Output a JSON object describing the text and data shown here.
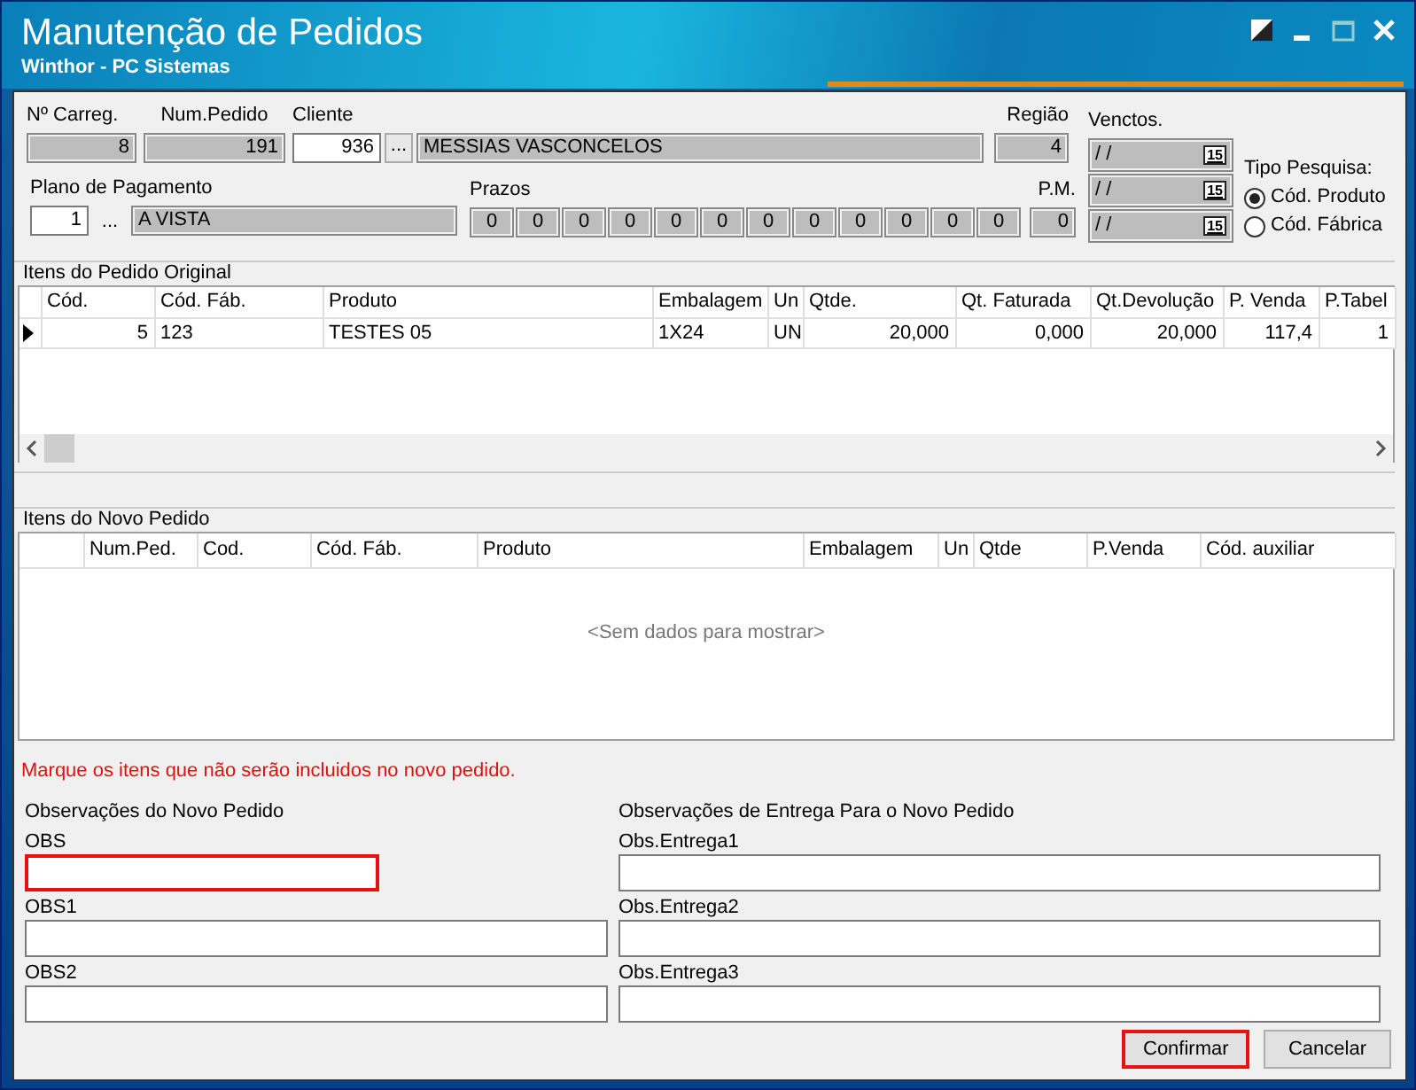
{
  "window": {
    "title": "Manutenção de Pedidos",
    "subtitle": "Winthor - PC Sistemas"
  },
  "header": {
    "carga": {
      "label": "Nº Carreg.",
      "value": "8",
      "disabled": true
    },
    "num_pedido": {
      "label": "Num.Pedido",
      "value": "191",
      "disabled": true
    },
    "cliente": {
      "label": "Cliente",
      "code": "936",
      "lookup": "...",
      "name": "MESSIAS VASCONCELOS"
    },
    "regiao": {
      "label": "Região",
      "value": "4",
      "disabled": true
    },
    "plano_pagamento": {
      "label": "Plano de Pagamento",
      "code": "1",
      "lookup": "...",
      "name": "A VISTA"
    },
    "prazos": {
      "label": "Prazos",
      "values": [
        "0",
        "0",
        "0",
        "0",
        "0",
        "0",
        "0",
        "0",
        "0",
        "0",
        "0",
        "0"
      ]
    },
    "pm": {
      "label": "P.M.",
      "value": "0",
      "disabled": true
    },
    "venctos": {
      "label": "Venctos.",
      "dates": [
        {
          "value": "/ /",
          "button": "15"
        },
        {
          "value": "/ /",
          "button": "15"
        },
        {
          "value": "/ /",
          "button": "15"
        }
      ]
    },
    "tipo_pesquisa": {
      "label": "Tipo Pesquisa:",
      "options": [
        {
          "label": "Cód. Produto",
          "selected": true
        },
        {
          "label": "Cód. Fábrica",
          "selected": false
        }
      ]
    }
  },
  "original_items": {
    "title": "Itens do Pedido Original",
    "columns": [
      "Cód.",
      "Cód. Fáb.",
      "Produto",
      "Embalagem",
      "Un",
      "Qtde.",
      "Qt. Faturada",
      "Qt.Devolução",
      "P. Venda",
      "P.Tabel"
    ],
    "rows": [
      {
        "current": true,
        "cells": [
          "5",
          "123",
          "TESTES 05",
          "1X24",
          "UN",
          "20,000",
          "0,000",
          "20,000",
          "117,4",
          "1"
        ]
      }
    ]
  },
  "new_items": {
    "title": "Itens do Novo Pedido",
    "columns": [
      "Num.Ped.",
      "Cod.",
      "Cód. Fáb.",
      "Produto",
      "Embalagem",
      "Un",
      "Qtde",
      "P.Venda",
      "Cód. auxiliar"
    ],
    "empty_text": "<Sem dados para mostrar>"
  },
  "notice": "Marque os itens que não serão incluidos no novo pedido.",
  "observacoes": {
    "title": "Observações do Novo Pedido",
    "fields": [
      {
        "label": "OBS",
        "highlighted": true
      },
      {
        "label": "OBS1",
        "highlighted": false
      },
      {
        "label": "OBS2",
        "highlighted": false
      }
    ]
  },
  "entrega": {
    "title": "Observações de Entrega Para o Novo Pedido",
    "fields": [
      {
        "label": "Obs.Entrega1",
        "highlighted": false
      },
      {
        "label": "Obs.Entrega2",
        "highlighted": false
      },
      {
        "label": "Obs.Entrega3",
        "highlighted": false
      }
    ]
  },
  "buttons": [
    {
      "label": "Confirmar",
      "highlighted": true
    },
    {
      "label": "Cancelar",
      "highlighted": false
    }
  ]
}
